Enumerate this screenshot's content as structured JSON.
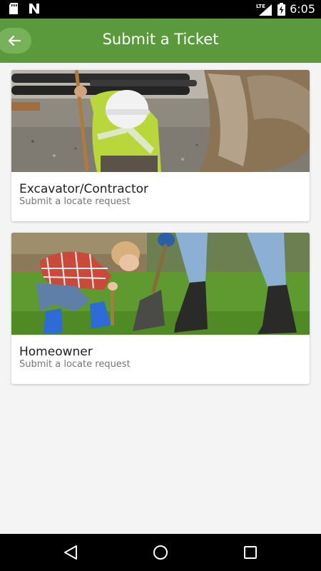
{
  "status_bar": {
    "time": "6:05",
    "network": "LTE",
    "icons": [
      "sd-card-icon",
      "n-notification-icon",
      "lte-signal-icon",
      "battery-icon"
    ]
  },
  "app_bar": {
    "title": "Submit a Ticket",
    "back_icon": "arrow-left-icon",
    "color": "#5a9a3c"
  },
  "cards": [
    {
      "title": "Excavator/Contractor",
      "subtitle": "Submit a locate request",
      "image": "construction-worker-photo"
    },
    {
      "title": "Homeowner",
      "subtitle": "Submit a locate request",
      "image": "child-digging-photo"
    }
  ],
  "nav_bar": {
    "icons": [
      "back-triangle-icon",
      "home-circle-icon",
      "recents-square-icon"
    ]
  }
}
